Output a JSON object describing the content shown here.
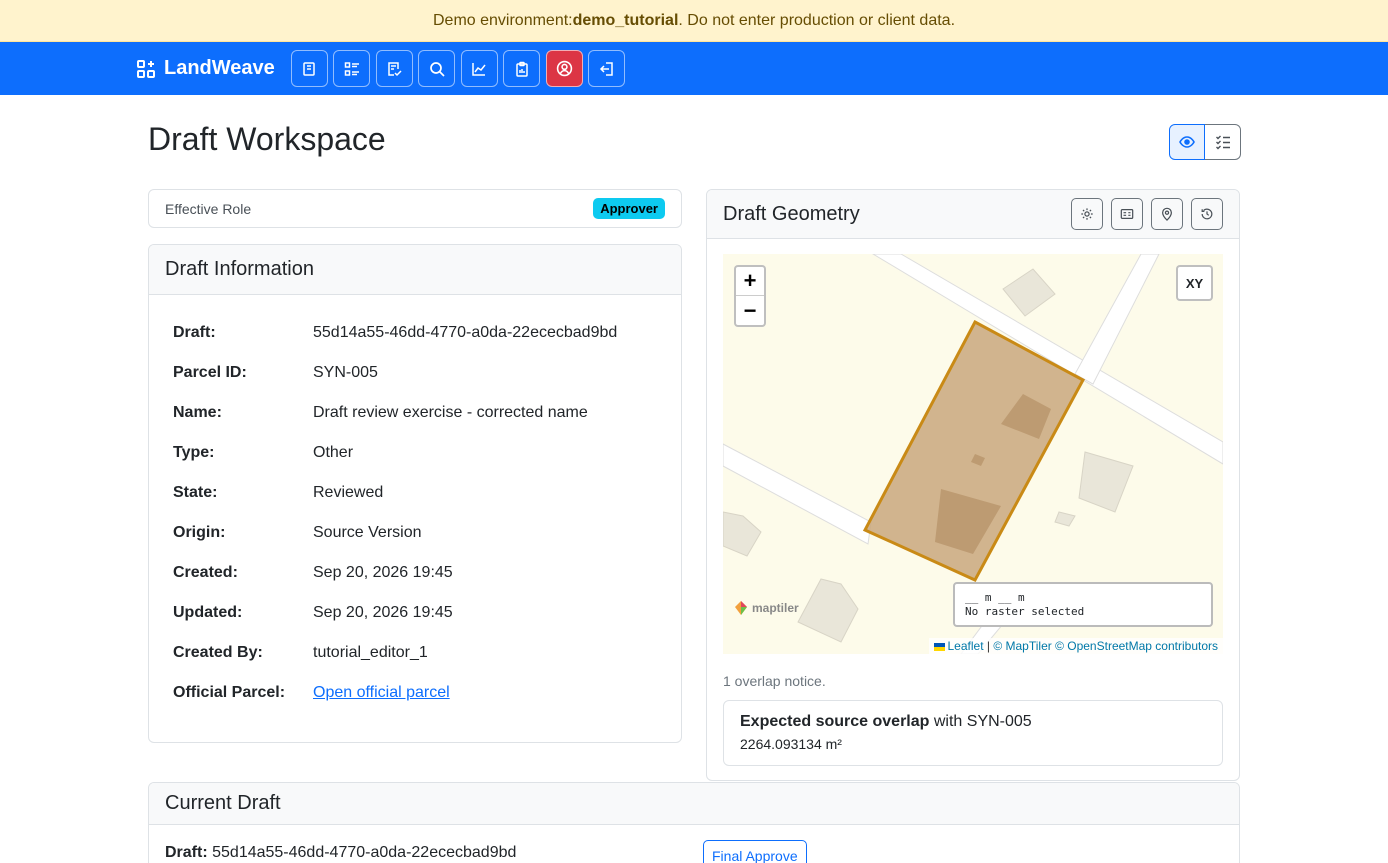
{
  "banner": {
    "prefix": "Demo environment: ",
    "env": "demo_tutorial",
    "suffix": ". Do not enter production or client data."
  },
  "brand": {
    "name": "LandWeave"
  },
  "nav": [
    {
      "icon": "book-icon"
    },
    {
      "icon": "list-details-icon"
    },
    {
      "icon": "checklist-icon"
    },
    {
      "icon": "search-icon"
    },
    {
      "icon": "chart-icon"
    },
    {
      "icon": "clipboard-icon"
    },
    {
      "icon": "user-circle-icon"
    },
    {
      "icon": "logout-icon"
    }
  ],
  "page": {
    "title": "Draft Workspace"
  },
  "role": {
    "label": "Effective Role",
    "value": "Approver"
  },
  "info": {
    "title": "Draft Information",
    "rows": [
      {
        "k": "Draft:",
        "v": "55d14a55-46dd-4770-a0da-22ececbad9bd"
      },
      {
        "k": "Parcel ID:",
        "v": "SYN-005"
      },
      {
        "k": "Name:",
        "v": "Draft review exercise - corrected name"
      },
      {
        "k": "Type:",
        "v": "Other"
      },
      {
        "k": "State:",
        "v": "Reviewed"
      },
      {
        "k": "Origin:",
        "v": "Source Version"
      },
      {
        "k": "Created:",
        "v": "Sep 20, 2026 19:45"
      },
      {
        "k": "Updated:",
        "v": "Sep 20, 2026 19:45"
      },
      {
        "k": "Created By:",
        "v": "tutorial_editor_1"
      },
      {
        "k": "Official Parcel:",
        "v": "Open official parcel"
      }
    ]
  },
  "geometry": {
    "title": "Draft Geometry",
    "map": {
      "zoom_in": "+",
      "zoom_out": "−",
      "xy_label": "XY",
      "coords_line1": "__ m __ m",
      "coords_line2": "No raster selected",
      "logo_text": "maptiler",
      "attr_leaflet": "Leaflet",
      "attr_sep": " | ",
      "attr_maptiler": "© MapTiler",
      "attr_osm": "© OpenStreetMap contributors"
    },
    "overlap_note": "1 overlap notice.",
    "overlap": {
      "title": "Expected source overlap",
      "with": " with SYN-005",
      "area": "2264.093134 m²"
    }
  },
  "current": {
    "title": "Current Draft",
    "label": "Draft:",
    "value": " 55d14a55-46dd-4770-a0da-22ececbad9bd",
    "action": "Final Approve"
  },
  "colors": {
    "primary": "#0d6efd",
    "parcel_stroke": "#c98a16",
    "parcel_fill": "#c9a77e"
  }
}
